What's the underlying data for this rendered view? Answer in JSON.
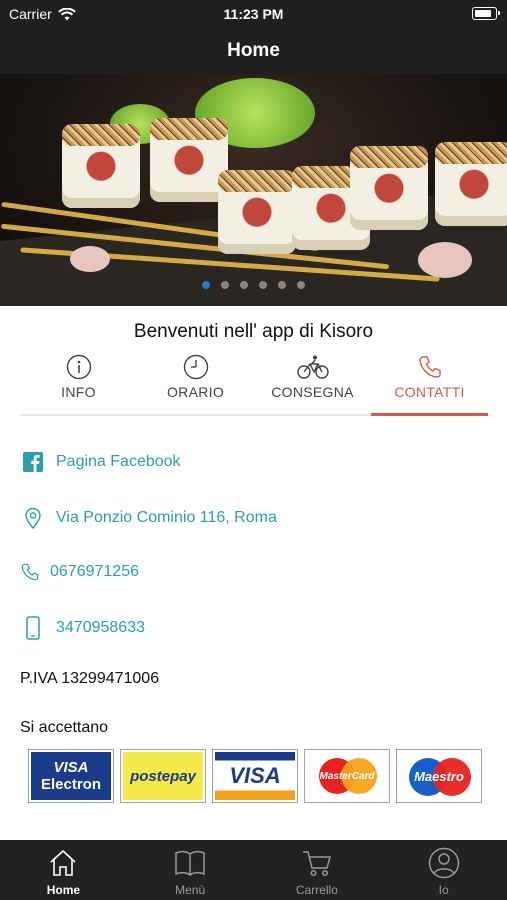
{
  "status_bar": {
    "carrier": "Carrier",
    "time": "11:23 PM"
  },
  "nav": {
    "title": "Home"
  },
  "carousel": {
    "page_count": 6,
    "active_index": 0
  },
  "welcome": "Benvenuti nell' app di Kisoro",
  "tabs": [
    {
      "label": "INFO",
      "icon": "info-icon"
    },
    {
      "label": "ORARIO",
      "icon": "clock-icon"
    },
    {
      "label": "CONSEGNA",
      "icon": "bicycle-icon"
    },
    {
      "label": "CONTATTI",
      "icon": "phone-icon",
      "active": true
    }
  ],
  "contacts": {
    "facebook": "Pagina Facebook",
    "address": "Via Ponzio Cominio 116, Roma",
    "phone": "0676971256",
    "mobile": "3470958633",
    "vat": "P.IVA 13299471006"
  },
  "payments": {
    "heading": "Si accettano",
    "cards": [
      {
        "name": "visa-electron",
        "line1": "VISA",
        "line2": "Electron"
      },
      {
        "name": "postepay",
        "line1": "postepay"
      },
      {
        "name": "visa",
        "line1": "VISA"
      },
      {
        "name": "mastercard",
        "line1": "MasterCard"
      },
      {
        "name": "maestro",
        "line1": "Maestro"
      }
    ]
  },
  "tabbar": [
    {
      "label": "Home",
      "icon": "home-icon",
      "active": true
    },
    {
      "label": "Menù",
      "icon": "book-icon"
    },
    {
      "label": "Carrello",
      "icon": "cart-icon"
    },
    {
      "label": "Io",
      "icon": "user-icon"
    }
  ],
  "colors": {
    "accent": "#d65a4a",
    "link": "#2b9fa8",
    "bar": "#1f1f1f"
  }
}
